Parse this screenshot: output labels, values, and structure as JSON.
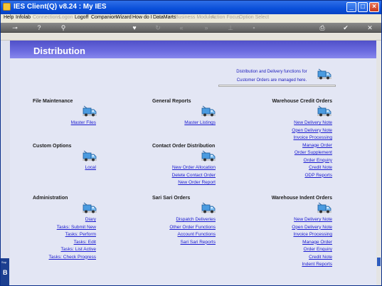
{
  "window": {
    "title": "IES Client(Q) v8.24 : My IES"
  },
  "menu": {
    "items": [
      {
        "label": "Help",
        "disabled": false
      },
      {
        "label": "Infolab",
        "disabled": false
      },
      {
        "label": "Connections",
        "disabled": true
      },
      {
        "label": "Logon",
        "disabled": true
      },
      {
        "label": "Logoff",
        "disabled": false
      },
      {
        "label": "Companion",
        "disabled": false
      },
      {
        "label": "Wizard",
        "disabled": false
      },
      {
        "label": "How do I",
        "disabled": false
      },
      {
        "label": "DataMarts",
        "disabled": false
      },
      {
        "label": "Business Modules",
        "disabled": true
      },
      {
        "label": "Action Focus",
        "disabled": true
      },
      {
        "label": "Option Select",
        "disabled": true
      }
    ]
  },
  "toolbar": {
    "icons": [
      "key-icon",
      "help-icon",
      "search-icon",
      "heart-icon",
      "refresh-icon",
      "back-double-icon",
      "forward-double-icon",
      "pin-icon",
      "document-icon",
      "printer-icon",
      "checkmark-icon",
      "close-icon"
    ]
  },
  "page": {
    "title": "Distribution",
    "intro_line1": "Distribution and Delivery functions for",
    "intro_line2": "Customer Orders are managed here."
  },
  "sections": {
    "file_maintenance": {
      "title": "File Maintenance",
      "links": [
        "Master Files"
      ]
    },
    "general_reports": {
      "title": "General Reports",
      "links": [
        "Master Listings"
      ]
    },
    "warehouse_credit_orders": {
      "title": "Warehouse Credit Orders",
      "links": [
        "New Delivery Note",
        "Open Delivery Note",
        "Invoice Processing",
        "Manage Order",
        "Order Supplement",
        "Order Enquiry",
        "Credit Note",
        "ODP Reports"
      ]
    },
    "custom_options": {
      "title": "Custom Options",
      "links": [
        "Local"
      ]
    },
    "contact_order_distribution": {
      "title": "Contact Order Distribution",
      "links": [
        "New Order Allocation",
        "Delete Contact Order",
        "New Order Report"
      ]
    },
    "administration": {
      "title": "Administration",
      "links": [
        "Diary",
        "Tasks: Submit New",
        "Tasks: Perform",
        "Tasks: Edit",
        "Tasks: List Active",
        "Tasks: Check Progress"
      ]
    },
    "sari_sari_orders": {
      "title": "Sari Sari Orders",
      "links": [
        "Dispatch Deliveries",
        "Other Order Functions",
        "Account Functions",
        "Sari Sari Reports"
      ]
    },
    "warehouse_indent_orders": {
      "title": "Warehouse Indent Orders",
      "links": [
        "New Delivery Note",
        "Open Delivery Note",
        "Invoice Processing",
        "Manage Order",
        "Order Enquiry",
        "Credit Note",
        "Indent Reports"
      ]
    }
  },
  "dock": {
    "label": "Sup",
    "letter": "B"
  },
  "colors": {
    "header": "#5a5ad2",
    "link": "#1b1bd0",
    "titlebar": "#0a4fd9",
    "icon": "#3b8fd8"
  }
}
